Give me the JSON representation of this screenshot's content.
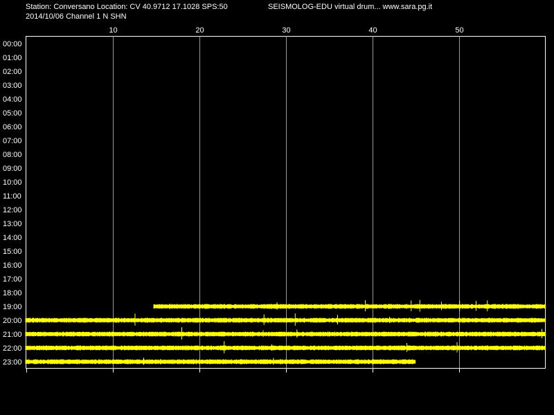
{
  "header": {
    "station_line": "Station: Conversano Location: CV 40.9712 17.1028 SPS:50",
    "branding": "SEISMOLOG-EDU virtual drum... www.sara.pg.it",
    "date_line": "2014/10/06  Channel 1 N SHN"
  },
  "colors": {
    "background": "#000000",
    "grid": "#9a9a9a",
    "frame": "#ffffff",
    "trace": "#ffff00",
    "text": "#ffffff"
  },
  "chart_data": {
    "type": "line",
    "description_free": true,
    "x_ticks": [
      10,
      20,
      30,
      40,
      50
    ],
    "xlim": [
      0,
      60
    ],
    "y_labels": [
      "00:00",
      "01:00",
      "02:00",
      "03:00",
      "04:00",
      "05:00",
      "06:00",
      "07:00",
      "08:00",
      "09:00",
      "10:00",
      "11:00",
      "12:00",
      "13:00",
      "14:00",
      "15:00",
      "16:00",
      "17:00",
      "18:00",
      "19:00",
      "20:00",
      "21:00",
      "22:00",
      "23:00"
    ],
    "grid": true,
    "traces": [
      {
        "hour": "19:00",
        "start_min": 14.8,
        "end_min": 60,
        "spikes_min": [
          29.0,
          39.2,
          44.5,
          45.5,
          48.0,
          50.1,
          52.0,
          53.3
        ]
      },
      {
        "hour": "20:00",
        "start_min": 0,
        "end_min": 60,
        "spikes_min": [
          12.6,
          27.5,
          31.1,
          36.0,
          42.0
        ]
      },
      {
        "hour": "21:00",
        "start_min": 0,
        "end_min": 60,
        "spikes_min": [
          18.0,
          27.4,
          31.3,
          59.6
        ]
      },
      {
        "hour": "22:00",
        "start_min": 0,
        "end_min": 60,
        "spikes_min": [
          22.9,
          28.4,
          44.0,
          49.8
        ]
      },
      {
        "hour": "23:00",
        "start_min": 0,
        "end_min": 45.0,
        "spikes_min": [
          13.6,
          28.6
        ]
      }
    ]
  }
}
